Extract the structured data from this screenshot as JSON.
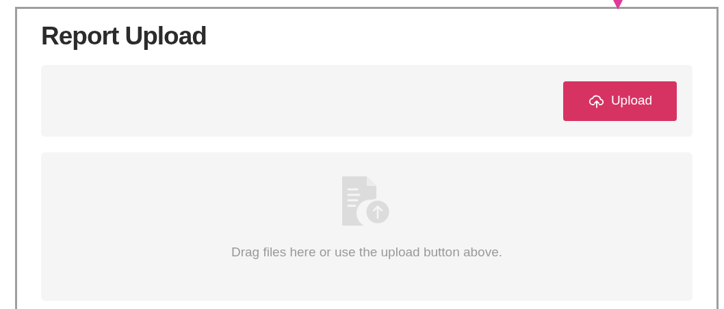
{
  "title": "Report Upload",
  "toolbar": {
    "upload_button": "Upload"
  },
  "dropzone": {
    "message": "Drag files here or use the upload button above."
  }
}
